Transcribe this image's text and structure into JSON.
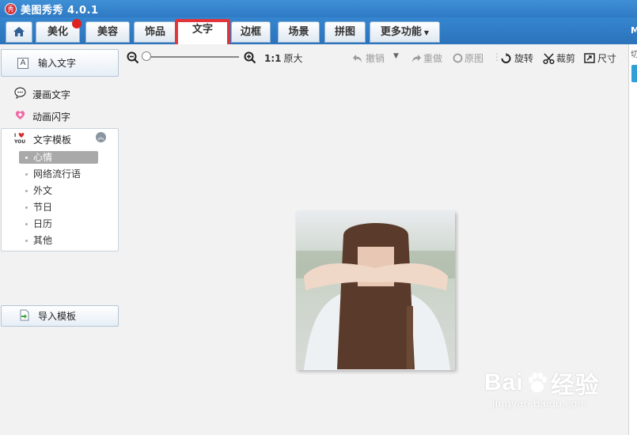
{
  "window": {
    "title": "美图秀秀 4.0.1",
    "logo_text": "秀"
  },
  "tabs": [
    {
      "label": "美化",
      "badge": true
    },
    {
      "label": "美容"
    },
    {
      "label": "饰品"
    },
    {
      "label": "文字",
      "active": true
    },
    {
      "label": "边框"
    },
    {
      "label": "场景"
    },
    {
      "label": "拼图"
    },
    {
      "label": "更多功能"
    }
  ],
  "window_controls": {
    "partial_text": "M"
  },
  "left_panel": {
    "input_text": "输入文字",
    "comic_text": "漫画文字",
    "animated_text": "动画闪字",
    "template_header": "文字模板",
    "template_icon_text": "I ♥ YOU",
    "templates": [
      "心情",
      "网络流行语",
      "外文",
      "节日",
      "日历",
      "其他"
    ],
    "selected_template": "心情",
    "import_template": "导入模板"
  },
  "toolbar": {
    "zoom_ratio": "1:1",
    "original_size": "原大",
    "undo": "撤销",
    "redo": "重做",
    "original_image": "原图",
    "rotate": "旋转",
    "crop": "裁剪",
    "resize": "尺寸"
  },
  "right_strip": {
    "partial_label": "切"
  },
  "watermark": {
    "brand_left": "Bai",
    "brand_right": "经验",
    "url": "jingyan.baidu.com"
  },
  "colors": {
    "title_bar": "#3e8fd6",
    "tab_bar": "#2f7ac4",
    "active_tab_highlight": "#e2353a",
    "badge": "#e02020",
    "panel_tab": "#2f9fd6"
  }
}
